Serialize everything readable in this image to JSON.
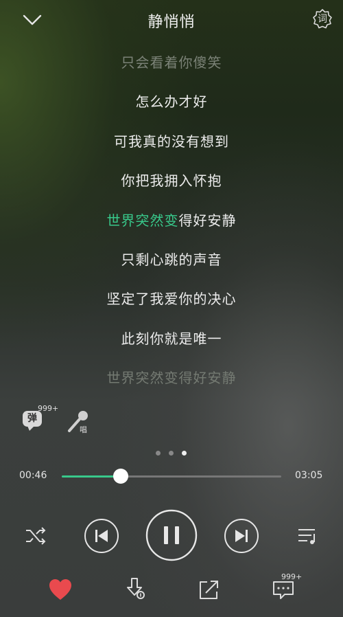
{
  "header": {
    "title": "静悄悄",
    "lyrics_badge": "词"
  },
  "lyrics": {
    "lines": [
      "只会看着你傻笑",
      "怎么办才好",
      "可我真的没有想到",
      "你把我拥入怀抱",
      "世界突然变得好安静",
      "只剩心跳的声音",
      "坚定了我爱你的决心",
      "此刻你就是唯一",
      "世界突然变得好安静"
    ],
    "current_sung_part": "世界突然变",
    "current_unsung_part": "得好安静"
  },
  "tools": {
    "danmu_label": "弹",
    "danmu_count": "999+",
    "sing_label": "唱"
  },
  "pager": {
    "count": 3,
    "active": 3
  },
  "player": {
    "elapsed": "00:46",
    "duration": "03:05",
    "progress": 0.27,
    "accent_color": "#38c98b",
    "state": "playing"
  },
  "bottom_bar": {
    "like_color": "#e94a4e",
    "comments_count": "999+"
  }
}
